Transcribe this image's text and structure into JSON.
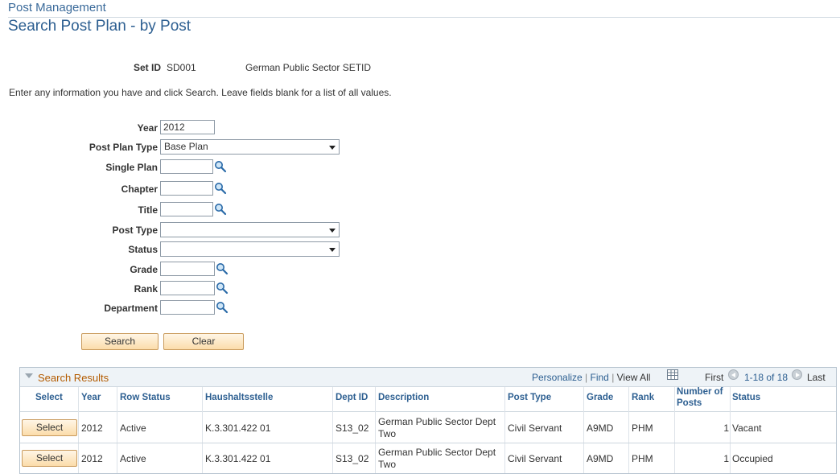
{
  "header": {
    "breadcrumb": "Post Management",
    "title": "Search Post Plan - by Post"
  },
  "setid": {
    "label": "Set ID",
    "value": "SD001",
    "description": "German Public Sector SETID"
  },
  "instructions": "Enter any information you have and click Search. Leave fields blank for a list of all values.",
  "form": {
    "year_label": "Year",
    "year_value": "2012",
    "post_plan_type_label": "Post Plan Type",
    "post_plan_type_value": "Base Plan",
    "single_plan_label": "Single Plan",
    "chapter_label": "Chapter",
    "title_label": "Title",
    "post_type_label": "Post Type",
    "status_label": "Status",
    "grade_label": "Grade",
    "rank_label": "Rank",
    "department_label": "Department"
  },
  "buttons": {
    "search": "Search",
    "clear": "Clear"
  },
  "results": {
    "title": "Search Results",
    "personalize": "Personalize",
    "find": "Find",
    "view_all": "View All",
    "first": "First",
    "range": "1-18 of 18",
    "last": "Last",
    "columns": {
      "select": "Select",
      "year": "Year",
      "row_status": "Row Status",
      "haushaltsstelle": "Haushaltsstelle",
      "dept_id": "Dept ID",
      "description": "Description",
      "post_type": "Post Type",
      "grade": "Grade",
      "rank": "Rank",
      "num_posts_1": "Number of",
      "num_posts_2": "Posts",
      "status": "Status"
    },
    "rows": [
      {
        "select": "Select",
        "year": "2012",
        "row_status": "Active",
        "haushaltsstelle": "K.3.301.422 01",
        "dept_id": "S13_02",
        "description_1": "German Public Sector Dept",
        "description_2": "Two",
        "post_type": "Civil Servant",
        "grade": "A9MD",
        "rank": "PHM",
        "num_posts": "1",
        "status": "Vacant"
      },
      {
        "select": "Select",
        "year": "2012",
        "row_status": "Active",
        "haushaltsstelle": "K.3.301.422 01",
        "dept_id": "S13_02",
        "description_1": "German Public Sector Dept",
        "description_2": "Two",
        "post_type": "Civil Servant",
        "grade": "A9MD",
        "rank": "PHM",
        "num_posts": "1",
        "status": "Occupied"
      }
    ]
  },
  "colors": {
    "accent": "#2d5f91",
    "grid_title": "#b35b00",
    "button_bg": "#fbdcaa"
  }
}
